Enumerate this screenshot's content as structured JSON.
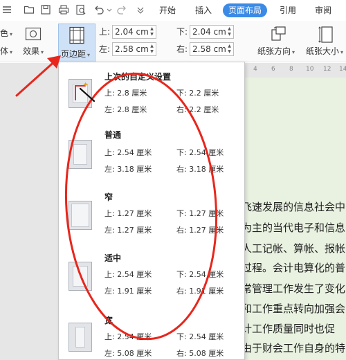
{
  "tabs": {
    "home": "开始",
    "insert": "插入",
    "page_layout": "页面布局",
    "references": "引用",
    "review": "审阅"
  },
  "ribbon": {
    "color_partial": "色",
    "font_partial": "体",
    "effects": "效果",
    "margins": "页边距",
    "orientation": "纸张方向",
    "size": "纸张大小",
    "top_label": "上:",
    "top_value": "2.04 cm",
    "bottom_label": "下:",
    "bottom_value": "2.04 cm",
    "left_label": "左:",
    "left_value": "2.58 cm",
    "right_label": "右:",
    "right_value": "2.58 cm"
  },
  "ruler": [
    "4",
    "6",
    "8",
    "10",
    "12",
    "14"
  ],
  "presets": [
    {
      "name": "上次的自定义设置",
      "top": "上: 2.8 厘米",
      "bottom": "下: 2.2 厘米",
      "left": "左: 2.8 厘米",
      "right": "右: 2.2 厘米"
    },
    {
      "name": "普通",
      "top": "上: 2.54 厘米",
      "bottom": "下: 2.54 厘米",
      "left": "左: 3.18 厘米",
      "right": "右: 3.18 厘米"
    },
    {
      "name": "窄",
      "top": "上: 1.27 厘米",
      "bottom": "下: 1.27 厘米",
      "left": "左: 1.27 厘米",
      "right": "右: 1.27 厘米"
    },
    {
      "name": "适中",
      "top": "上: 2.54 厘米",
      "bottom": "下: 2.54 厘米",
      "left": "左: 1.91 厘米",
      "right": "右: 1.91 厘米"
    },
    {
      "name": "宽",
      "top": "上: 2.54 厘米",
      "bottom": "下: 2.54 厘米",
      "left": "左: 5.08 厘米",
      "right": "右: 5.08 厘米"
    }
  ],
  "document": {
    "lines": [
      "飞速发展的信息社会中",
      "为主的当代电子和信息",
      "人工记帐、算帐、报帐",
      "过程。会计电算化的普",
      "常管理工作发生了变化",
      "和工作重点转向加强会",
      "计工作质量同时也促",
      "由于财会工作自身的特"
    ]
  },
  "colors": {
    "accent": "#3b8ae5",
    "annotation": "#e8261c",
    "page_tint": "#e9f2e1"
  }
}
